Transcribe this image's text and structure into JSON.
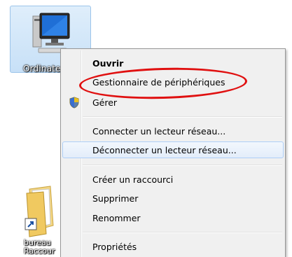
{
  "desktop": {
    "computer_label": "Ordinate",
    "shortcut_label_line1": "bureau",
    "shortcut_label_line2": "Raccour"
  },
  "context_menu": {
    "items": [
      {
        "label": "Ouvrir",
        "bold": true
      },
      {
        "label": "Gestionnaire de périphériques",
        "highlighted_with_red_oval": true
      },
      {
        "label": "Gérer",
        "icon": "uac-shield-icon"
      },
      {
        "label": "Connecter un lecteur réseau..."
      },
      {
        "label": "Déconnecter un lecteur réseau...",
        "hovered": true
      },
      {
        "label": "Créer un raccourci"
      },
      {
        "label": "Supprimer"
      },
      {
        "label": "Renommer"
      },
      {
        "label": "Propriétés"
      }
    ]
  },
  "colors": {
    "annotation_oval": "#e01010",
    "hover_border": "#aecff7",
    "menu_background": "#f0f0f0"
  }
}
